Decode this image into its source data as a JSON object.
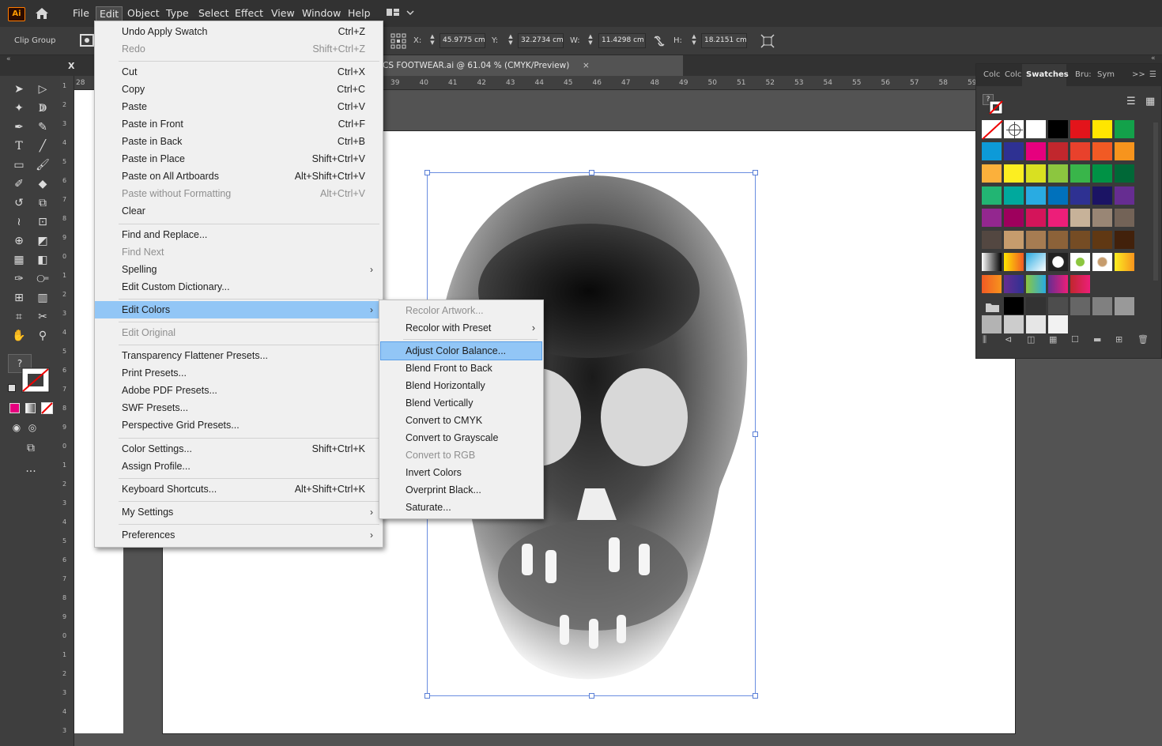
{
  "app": {
    "logo_text": "Ai"
  },
  "menubar": {
    "items": [
      "File",
      "Edit",
      "Object",
      "Type",
      "Select",
      "Effect",
      "View",
      "Window",
      "Help"
    ]
  },
  "controlbar": {
    "selection_label": "Clip Group",
    "x_label": "X:",
    "x_value": "45.9775 cm",
    "y_label": "Y:",
    "y_value": "32.2734 cm",
    "w_label": "W:",
    "w_value": "11.4298 cm",
    "h_label": "H:",
    "h_value": "18.2151 cm"
  },
  "tools_panel": {
    "header": "XRAY"
  },
  "document": {
    "tab_title": "CS FOOTWEAR.ai @ 61.04 % (CMYK/Preview)",
    "close_glyph": "×",
    "hruler": [
      "28",
      "39",
      "40",
      "41",
      "42",
      "43",
      "44",
      "45",
      "46",
      "47",
      "48",
      "49",
      "50",
      "51",
      "52",
      "53",
      "54",
      "55",
      "56",
      "57",
      "58",
      "59"
    ],
    "vruler": [
      "1",
      "2",
      "3",
      "4",
      "5",
      "6",
      "7",
      "8",
      "9",
      "0",
      "1",
      "2",
      "3",
      "4",
      "5",
      "6",
      "7",
      "8",
      "9",
      "0",
      "1",
      "2",
      "3",
      "4",
      "5",
      "6",
      "7",
      "8",
      "9",
      "0",
      "1",
      "2",
      "3",
      "4",
      "3"
    ]
  },
  "swatches_panel": {
    "tabs": [
      "Colc",
      "Colc",
      "Swatches",
      "Bru:",
      "Sym"
    ],
    "active_tab": "Swatches",
    "help_glyph": "?",
    "expand_glyph": ">>",
    "colors_row1": [
      "none",
      "reg",
      "#ffffff",
      "#000000",
      "#e3141b",
      "#ffe600",
      "#13a14a"
    ],
    "colors_row2": [
      "#0d9ad8",
      "#2e3192",
      "#e6007e",
      "#c1272d",
      "#e8412c",
      "#f15a24",
      "#f7941d"
    ],
    "colors_row3": [
      "#fbb03b",
      "#fcee21",
      "#d9e021",
      "#8cc63f",
      "#39b54a",
      "#009245",
      "#006837"
    ],
    "colors_row4": [
      "#22b573",
      "#00a99d",
      "#29abe2",
      "#0071bc",
      "#2e3192",
      "#1b1464",
      "#662d91"
    ],
    "colors_row5": [
      "#93278f",
      "#9e005d",
      "#d4145a",
      "#ed1e79",
      "#c7b299",
      "#998675",
      "#736357"
    ],
    "colors_row6": [
      "#534741",
      "#c69c6d",
      "#a67c52",
      "#8c6239",
      "#754c24",
      "#603813",
      "#42210b"
    ],
    "grays": [
      "#000000",
      "#333333",
      "#4d4d4d",
      "#666666",
      "#808080",
      "#999999",
      "#b3b3b3",
      "#cccccc",
      "#e6e6e6",
      "#f2f2f2"
    ]
  },
  "edit_menu": {
    "items": [
      {
        "label": "Undo Apply Swatch",
        "shortcut": "Ctrl+Z",
        "disabled": false
      },
      {
        "label": "Redo",
        "shortcut": "Shift+Ctrl+Z",
        "disabled": true
      },
      {
        "label": "Cut",
        "shortcut": "Ctrl+X",
        "disabled": false
      },
      {
        "label": "Copy",
        "shortcut": "Ctrl+C",
        "disabled": false
      },
      {
        "label": "Paste",
        "shortcut": "Ctrl+V",
        "disabled": false
      },
      {
        "label": "Paste in Front",
        "shortcut": "Ctrl+F",
        "disabled": false
      },
      {
        "label": "Paste in Back",
        "shortcut": "Ctrl+B",
        "disabled": false
      },
      {
        "label": "Paste in Place",
        "shortcut": "Shift+Ctrl+V",
        "disabled": false
      },
      {
        "label": "Paste on All Artboards",
        "shortcut": "Alt+Shift+Ctrl+V",
        "disabled": false
      },
      {
        "label": "Paste without Formatting",
        "shortcut": "Alt+Ctrl+V",
        "disabled": true
      },
      {
        "label": "Clear",
        "shortcut": "",
        "disabled": false
      },
      {
        "label": "Find and Replace...",
        "shortcut": "",
        "disabled": false
      },
      {
        "label": "Find Next",
        "shortcut": "",
        "disabled": true
      },
      {
        "label": "Spelling",
        "shortcut": "",
        "disabled": false,
        "submenu": true
      },
      {
        "label": "Edit Custom Dictionary...",
        "shortcut": "",
        "disabled": false
      },
      {
        "label": "Edit Colors",
        "shortcut": "",
        "disabled": false,
        "submenu": true,
        "highlighted": true
      },
      {
        "label": "Edit Original",
        "shortcut": "",
        "disabled": true
      },
      {
        "label": "Transparency Flattener Presets...",
        "shortcut": "",
        "disabled": false
      },
      {
        "label": "Print Presets...",
        "shortcut": "",
        "disabled": false
      },
      {
        "label": "Adobe PDF Presets...",
        "shortcut": "",
        "disabled": false
      },
      {
        "label": "SWF Presets...",
        "shortcut": "",
        "disabled": false
      },
      {
        "label": "Perspective Grid Presets...",
        "shortcut": "",
        "disabled": false
      },
      {
        "label": "Color Settings...",
        "shortcut": "Shift+Ctrl+K",
        "disabled": false
      },
      {
        "label": "Assign Profile...",
        "shortcut": "",
        "disabled": false
      },
      {
        "label": "Keyboard Shortcuts...",
        "shortcut": "Alt+Shift+Ctrl+K",
        "disabled": false
      },
      {
        "label": "My Settings",
        "shortcut": "",
        "disabled": false,
        "submenu": true
      },
      {
        "label": "Preferences",
        "shortcut": "",
        "disabled": false,
        "submenu": true
      }
    ]
  },
  "edit_colors_submenu": {
    "items": [
      {
        "label": "Recolor Artwork...",
        "disabled": true
      },
      {
        "label": "Recolor with Preset",
        "disabled": false,
        "submenu": true
      },
      {
        "label": "Adjust Color Balance...",
        "disabled": false,
        "highlighted": true
      },
      {
        "label": "Blend Front to Back",
        "disabled": false
      },
      {
        "label": "Blend Horizontally",
        "disabled": false
      },
      {
        "label": "Blend Vertically",
        "disabled": false
      },
      {
        "label": "Convert to CMYK",
        "disabled": false
      },
      {
        "label": "Convert to Grayscale",
        "disabled": false
      },
      {
        "label": "Convert to RGB",
        "disabled": true
      },
      {
        "label": "Invert Colors",
        "disabled": false
      },
      {
        "label": "Overprint Black...",
        "disabled": false
      },
      {
        "label": "Saturate...",
        "disabled": false
      }
    ]
  },
  "glyphs": {
    "submenu_arrow": "›"
  }
}
